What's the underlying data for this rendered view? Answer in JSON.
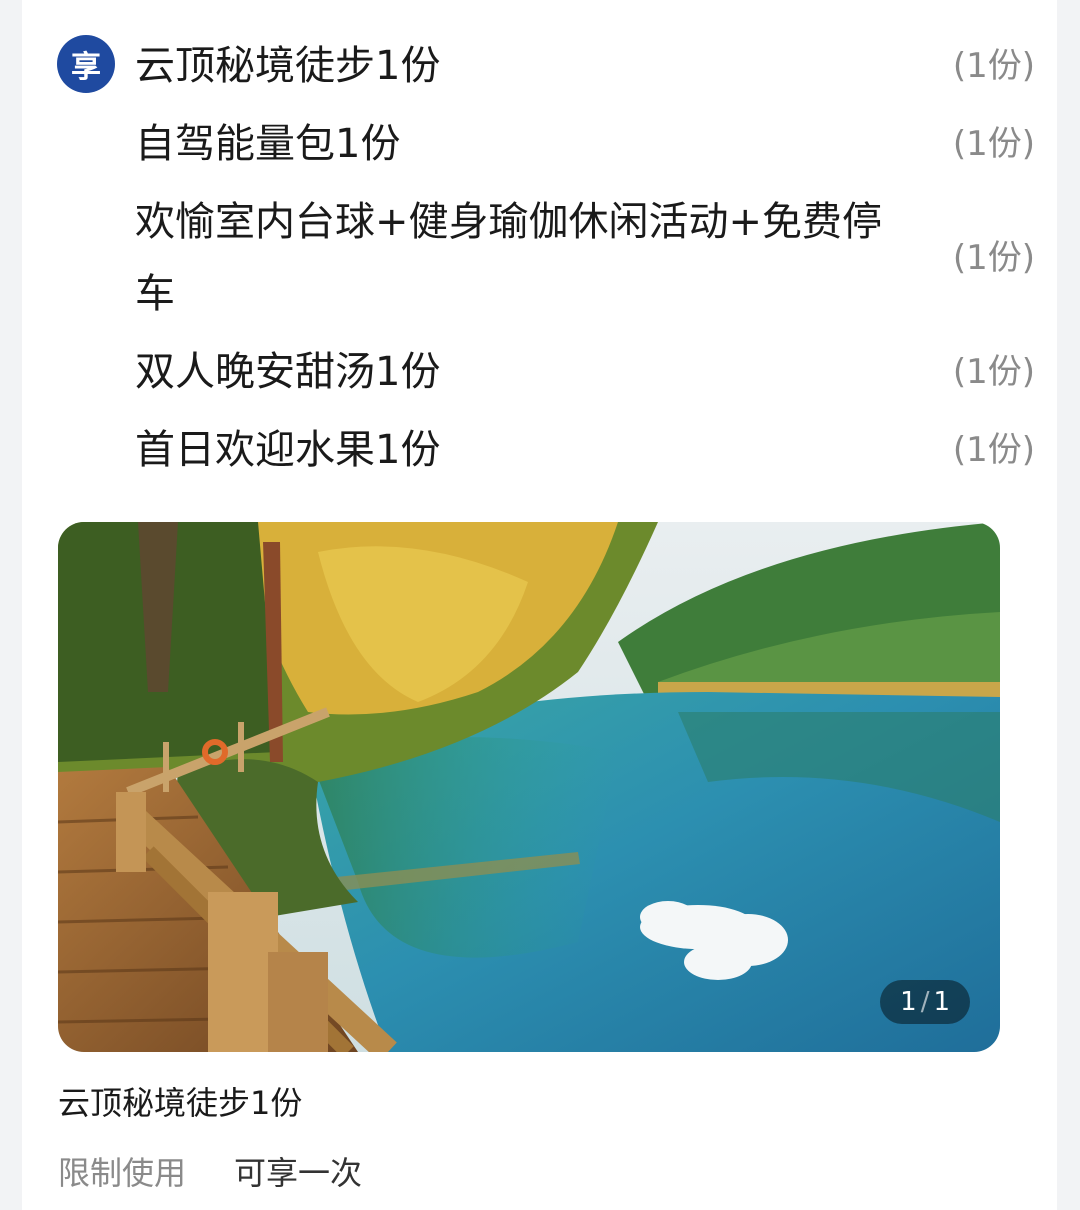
{
  "badge": {
    "label": "享"
  },
  "items": [
    {
      "name": "云顶秘境徒步1份",
      "qty": "(1份)"
    },
    {
      "name": "自驾能量包1份",
      "qty": "(1份)"
    },
    {
      "name": "欢愉室内台球+健身瑜伽休闲活动+免费停车",
      "qty": "(1份)"
    },
    {
      "name": "双人晚安甜汤1份",
      "qty": "(1份)"
    },
    {
      "name": "首日欢迎水果1份",
      "qty": "(1份)"
    }
  ],
  "gallery": {
    "current": "1",
    "separator": "/",
    "total": "1"
  },
  "caption": "云顶秘境徒步1份",
  "limit": {
    "label": "限制使用",
    "value": "可享一次"
  }
}
